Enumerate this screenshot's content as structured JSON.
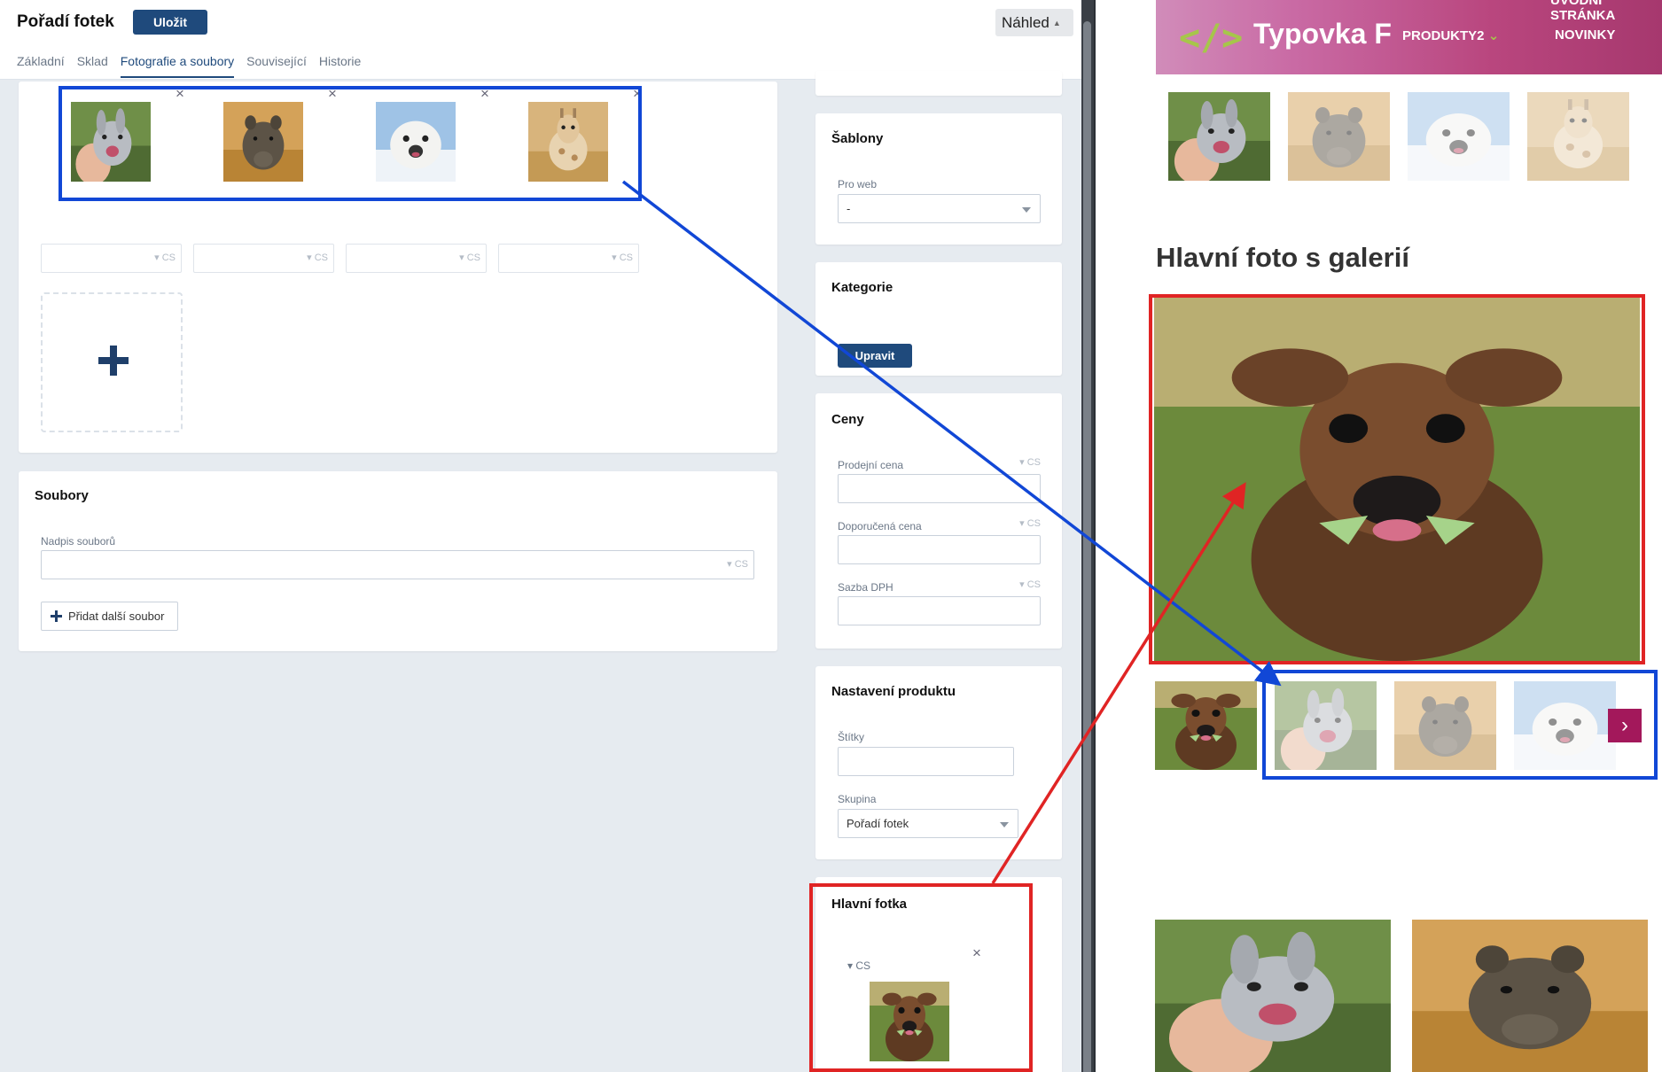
{
  "admin": {
    "title": "Pořadí fotek",
    "save_label": "Uložit",
    "preview_label": "Náhled",
    "tabs": [
      {
        "label": "Základní",
        "active": false
      },
      {
        "label": "Sklad",
        "active": false
      },
      {
        "label": "Fotografie a soubory",
        "active": true
      },
      {
        "label": "Související",
        "active": false
      },
      {
        "label": "Historie",
        "active": false
      }
    ],
    "gallery": {
      "images": [
        "rabbit-photo",
        "rhino-photo",
        "seal-photo",
        "giraffe-photo"
      ],
      "lang_tag": "CS",
      "close_glyph": "×"
    },
    "files": {
      "title": "Soubory",
      "caption_label": "Nadpis souborů",
      "lang_tag": "CS",
      "add_file_label": "Přidat další soubor"
    },
    "templates": {
      "title": "Šablony",
      "web_label": "Pro web",
      "web_value": "-"
    },
    "category": {
      "title": "Kategorie",
      "edit_label": "Upravit"
    },
    "prices": {
      "title": "Ceny",
      "sale_price_label": "Prodejní cena",
      "recommended_price_label": "Doporučená cena",
      "vat_label": "Sazba DPH",
      "lang_tag": "CS"
    },
    "product_settings": {
      "title": "Nastavení produktu",
      "tags_label": "Štítky",
      "group_label": "Skupina",
      "group_value": "Pořadí fotek"
    },
    "main_photo": {
      "title": "Hlavní fotka",
      "lang_tag": "CS",
      "close_glyph": "×",
      "image": "deer-photo"
    }
  },
  "web": {
    "logo_mark": "</>",
    "logo_text": "Typovka F",
    "nav": [
      "ÚVODNÍ STRÁNKA",
      "PRODUKTY2",
      "NOVINKY"
    ],
    "nav_chevron": "⌄",
    "gallery_heading": "Hlavní foto s galerií",
    "next_glyph": "›"
  },
  "colors": {
    "primary": "#1f4a7c",
    "highlight_blue": "#1147d6",
    "highlight_red": "#e02424",
    "web_accent": "#a3185b",
    "logo_green": "#a6c64a"
  }
}
